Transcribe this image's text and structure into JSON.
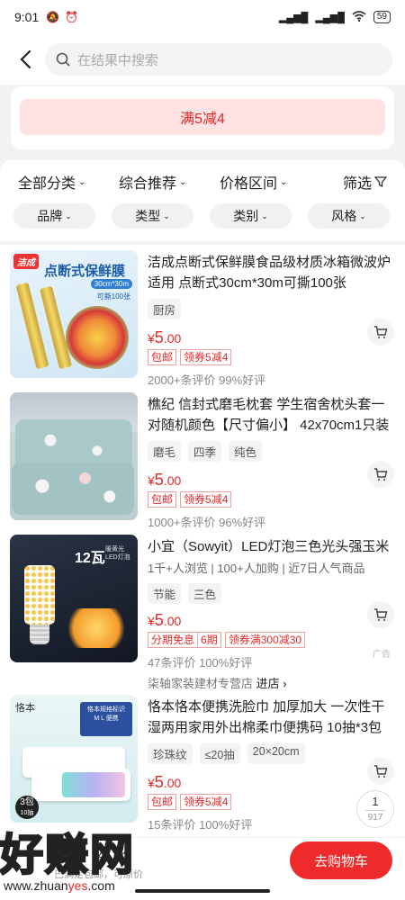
{
  "status": {
    "time": "9:01",
    "battery": "59"
  },
  "search": {
    "placeholder": "在结果中搜索"
  },
  "banner": {
    "text": "满5减4"
  },
  "sort": {
    "all": "全部分类",
    "recommend": "综合推荐",
    "price": "价格区间",
    "filter": "筛选"
  },
  "chips": [
    "品牌",
    "类型",
    "类别",
    "风格"
  ],
  "products": [
    {
      "title": "洁成点断式保鲜膜食品级材质冰箱微波炉适用 点断式30cm*30m可撕100张",
      "tags": [
        "厨房"
      ],
      "price_symbol": "¥",
      "price_int": "5",
      "price_dec": ".00",
      "promos": [
        "包邮",
        "领券5减4"
      ],
      "reviews": "2000+条评价  99%好评",
      "thumb": {
        "brand": "洁成",
        "headline": "点断式保鲜膜",
        "spec": "30cm*30m",
        "note": "可撕100张"
      }
    },
    {
      "title": "樵纪 信封式磨毛枕套 学生宿舍枕头套一对随机颜色【尺寸偏小】 42x70cm1只装",
      "tags": [
        "磨毛",
        "四季",
        "纯色"
      ],
      "price_symbol": "¥",
      "price_int": "5",
      "price_dec": ".00",
      "promos": [
        "包邮",
        "领券5减4"
      ],
      "reviews": "1000+条评价  96%好评"
    },
    {
      "title": "小宜（Sowyit）LED灯泡三色光头强玉米吊...",
      "meta": "1千+人浏览 | 100+人加购 | 近7日人气商品",
      "tags": [
        "节能",
        "三色"
      ],
      "price_symbol": "¥",
      "price_int": "5",
      "price_dec": ".00",
      "promos": [
        "分期免息",
        "6期",
        "领券满300减30"
      ],
      "reviews": "47条评价  100%好评",
      "shop": "柒轴家装建材专营店",
      "shop_link": "进店 ›",
      "ad": "广告",
      "thumb": {
        "power": "12瓦",
        "sub": "暖黄光 LED灯泡"
      }
    },
    {
      "title": "恪本恪本便携洗脸巾 加厚加大 一次性干湿两用家用外出棉柔巾便携码 10抽*3包(20...",
      "tags": [
        "珍珠纹",
        "≤20抽",
        "20×20cm"
      ],
      "price_symbol": "¥",
      "price_int": "5",
      "price_dec": ".00",
      "promos": [
        "包邮",
        "领券5减4"
      ],
      "reviews": "15条评价  100%好评",
      "thumb": {
        "brand": "恪本",
        "box": "恪本规格标识",
        "sizes": "M L 便携",
        "count": "3包",
        "unit": "10抽"
      }
    }
  ],
  "pager": {
    "current": "1",
    "total": "917"
  },
  "bottom": {
    "summary": "小计：¥0.00",
    "sub": "已满足包邮，可原价",
    "go_cart": "去购物车"
  },
  "watermark": {
    "text": "好赚网",
    "url_a": "www.zhuan",
    "url_b": "yes",
    "url_c": ".com"
  },
  "colors": {
    "accent": "#ee2a2a",
    "price": "#e02a2a",
    "banner_bg": "#ffe2e2"
  }
}
